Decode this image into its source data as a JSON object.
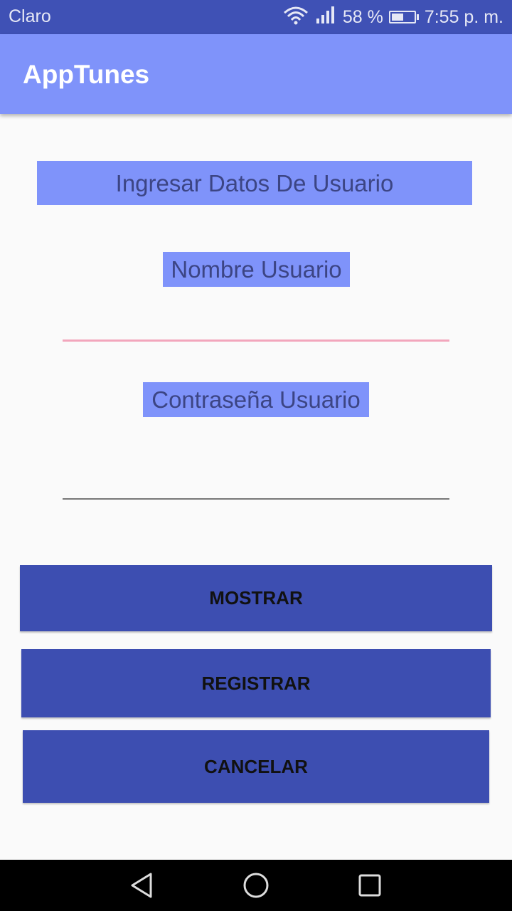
{
  "status_bar": {
    "carrier": "Claro",
    "battery_percent": "58 %",
    "battery_level": 0.58,
    "time": "7:55 p. m.",
    "icons": [
      "wifi-icon",
      "signal-icon",
      "battery-icon"
    ]
  },
  "app_bar": {
    "title": "AppTunes"
  },
  "form": {
    "heading": "Ingresar Datos De Usuario",
    "username_label": "Nombre Usuario",
    "username_value": "",
    "password_label": "Contraseña Usuario",
    "password_value": ""
  },
  "buttons": {
    "mostrar": "MOSTRAR",
    "registrar": "REGISTRAR",
    "cancelar": "CANCELAR"
  },
  "nav_bar": {
    "icons": [
      "back-icon",
      "home-icon",
      "recents-icon"
    ]
  },
  "colors": {
    "status_bar": "#3f51b5",
    "app_bar": "#7f93fa",
    "label_background": "#7f93fa",
    "button_background": "#3d4eb1",
    "focused_field_underline": "#f2a6bc"
  }
}
